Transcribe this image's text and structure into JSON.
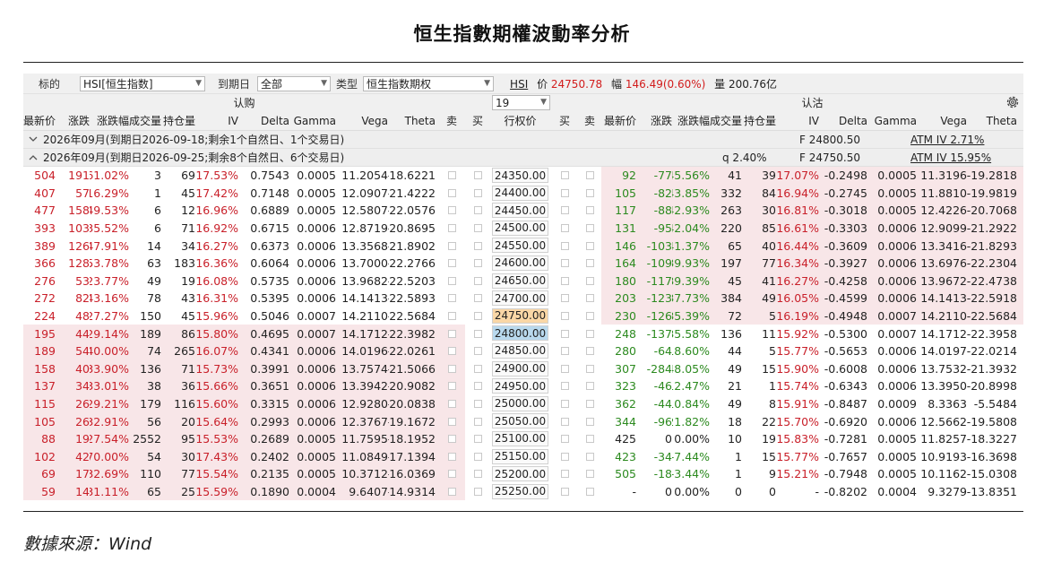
{
  "title": "恒生指數期權波動率分析",
  "source": "數據來源：Wind",
  "toolbar": {
    "underlying_label": "标的",
    "underlying_value": "HSI[恒生指数]",
    "expiry_label": "到期日",
    "expiry_value": "全部",
    "type_label": "类型",
    "type_value": "恒生指数期权",
    "quote_symbol": "HSI",
    "price_label": "价",
    "price_value": "24750.78",
    "change_label": "幅",
    "change_value": "146.49(0.60%)",
    "volume_label": "量",
    "volume_value": "200.76亿"
  },
  "header": {
    "call_label": "认购",
    "put_label": "认沽",
    "strike_count_value": "19",
    "call_cols": [
      "最新价",
      "涨跌",
      "涨跌幅",
      "成交量",
      "持仓量",
      "IV",
      "Delta",
      "Gamma",
      "Vega",
      "Theta"
    ],
    "mid_cols": [
      "卖",
      "买",
      "行权价",
      "买",
      "卖"
    ],
    "put_cols": [
      "最新价",
      "涨跌",
      "涨跌幅",
      "成交量",
      "持仓量",
      "IV",
      "Delta",
      "Gamma",
      "Vega",
      "Theta"
    ]
  },
  "groups": [
    {
      "label": "2026年09月(到期日2026-09-18;剩余1个自然日、1个交易日)",
      "f": "F  24800.50",
      "q": "",
      "atm": "ATM IV 2.71%",
      "expanded": false
    },
    {
      "label": "2026年09月(到期日2026-09-25;剩余8个自然日、6个交易日)",
      "f": "F  24750.50",
      "q": "q  2.40%",
      "atm": "ATM IV 15.95%",
      "expanded": true
    }
  ],
  "colors": {
    "up": "#c9202a",
    "down": "#2c8a1f",
    "itm_band": "#f8e6e8",
    "atm_strike": "#fad7a6",
    "near_strike": "#b9d9ee"
  },
  "rows": [
    {
      "strike": "24350.00",
      "call": [
        "504",
        "191",
        "61.02%",
        "3",
        "69",
        "17.53%",
        "0.7543",
        "0.0005",
        "11.2054",
        "-18.6221"
      ],
      "put": [
        "92",
        "-77",
        "-45.56%",
        "41",
        "39",
        "17.07%",
        "-0.2498",
        "0.0005",
        "11.3196",
        "-19.2818"
      ]
    },
    {
      "strike": "24400.00",
      "call": [
        "407",
        "57",
        "16.29%",
        "1",
        "45",
        "17.42%",
        "0.7148",
        "0.0005",
        "12.0907",
        "-21.4222"
      ],
      "put": [
        "105",
        "-82",
        "-43.85%",
        "332",
        "84",
        "16.94%",
        "-0.2745",
        "0.0005",
        "11.8810",
        "-19.9819"
      ]
    },
    {
      "strike": "24450.00",
      "call": [
        "477",
        "158",
        "49.53%",
        "6",
        "12",
        "16.96%",
        "0.6889",
        "0.0005",
        "12.5807",
        "-22.0576"
      ],
      "put": [
        "117",
        "-88",
        "-42.93%",
        "263",
        "30",
        "16.81%",
        "-0.3018",
        "0.0005",
        "12.4226",
        "-20.7068"
      ]
    },
    {
      "strike": "24500.00",
      "call": [
        "393",
        "103",
        "35.52%",
        "6",
        "71",
        "16.92%",
        "0.6715",
        "0.0006",
        "12.8719",
        "-20.8695"
      ],
      "put": [
        "131",
        "-95",
        "-42.04%",
        "220",
        "85",
        "16.61%",
        "-0.3303",
        "0.0006",
        "12.9099",
        "-21.2922"
      ]
    },
    {
      "strike": "24550.00",
      "call": [
        "389",
        "126",
        "47.91%",
        "14",
        "34",
        "16.27%",
        "0.6373",
        "0.0006",
        "13.3568",
        "-21.8902"
      ],
      "put": [
        "146",
        "-103",
        "-41.37%",
        "65",
        "40",
        "16.44%",
        "-0.3609",
        "0.0006",
        "13.3416",
        "-21.8293"
      ]
    },
    {
      "strike": "24600.00",
      "call": [
        "366",
        "128",
        "53.78%",
        "63",
        "183",
        "16.36%",
        "0.6064",
        "0.0006",
        "13.7000",
        "-22.2766"
      ],
      "put": [
        "164",
        "-109",
        "-39.93%",
        "197",
        "77",
        "16.34%",
        "-0.3927",
        "0.0006",
        "13.6976",
        "-22.2304"
      ]
    },
    {
      "strike": "24650.00",
      "call": [
        "276",
        "53",
        "23.77%",
        "49",
        "19",
        "16.08%",
        "0.5735",
        "0.0006",
        "13.9682",
        "-22.5203"
      ],
      "put": [
        "180",
        "-117",
        "-39.39%",
        "45",
        "41",
        "16.27%",
        "-0.4258",
        "0.0006",
        "13.9672",
        "-22.4738"
      ]
    },
    {
      "strike": "24700.00",
      "call": [
        "272",
        "82",
        "43.16%",
        "78",
        "43",
        "16.31%",
        "0.5395",
        "0.0006",
        "14.1413",
        "-22.5893"
      ],
      "put": [
        "203",
        "-123",
        "-37.73%",
        "384",
        "49",
        "16.05%",
        "-0.4599",
        "0.0006",
        "14.1413",
        "-22.5918"
      ]
    },
    {
      "strike": "24750.00",
      "call": [
        "224",
        "48",
        "27.27%",
        "150",
        "45",
        "15.96%",
        "0.5046",
        "0.0007",
        "14.2110",
        "-22.5684"
      ],
      "put": [
        "230",
        "-126",
        "-35.39%",
        "72",
        "5",
        "16.19%",
        "-0.4948",
        "0.0007",
        "14.2110",
        "-22.5684"
      ]
    },
    {
      "strike": "24800.00",
      "call": [
        "195",
        "44",
        "29.14%",
        "189",
        "86",
        "15.80%",
        "0.4695",
        "0.0007",
        "14.1712",
        "-22.3982"
      ],
      "put": [
        "248",
        "-137",
        "-35.58%",
        "136",
        "11",
        "15.92%",
        "-0.5300",
        "0.0007",
        "14.1712",
        "-22.3958"
      ]
    },
    {
      "strike": "24850.00",
      "call": [
        "189",
        "54",
        "40.00%",
        "74",
        "265",
        "16.07%",
        "0.4341",
        "0.0006",
        "14.0196",
        "-22.0261"
      ],
      "put": [
        "280",
        "-64",
        "-18.60%",
        "44",
        "5",
        "15.77%",
        "-0.5653",
        "0.0006",
        "14.0197",
        "-22.0214"
      ]
    },
    {
      "strike": "24900.00",
      "call": [
        "158",
        "40",
        "33.90%",
        "136",
        "71",
        "15.73%",
        "0.3991",
        "0.0006",
        "13.7574",
        "-21.5066"
      ],
      "put": [
        "307",
        "-284",
        "-48.05%",
        "49",
        "15",
        "15.90%",
        "-0.6008",
        "0.0006",
        "13.7532",
        "-21.3932"
      ]
    },
    {
      "strike": "24950.00",
      "call": [
        "137",
        "34",
        "33.01%",
        "38",
        "36",
        "15.66%",
        "0.3651",
        "0.0006",
        "13.3942",
        "-20.9082"
      ],
      "put": [
        "323",
        "-46",
        "-12.47%",
        "21",
        "1",
        "15.74%",
        "-0.6343",
        "0.0006",
        "13.3950",
        "-20.8998"
      ]
    },
    {
      "strike": "25000.00",
      "call": [
        "115",
        "26",
        "29.21%",
        "179",
        "116",
        "15.60%",
        "0.3315",
        "0.0006",
        "12.9280",
        "-20.0838"
      ],
      "put": [
        "362",
        "-44",
        "-10.84%",
        "49",
        "8",
        "15.91%",
        "-0.8487",
        "0.0009",
        "8.3363",
        "-5.5484"
      ]
    },
    {
      "strike": "25050.00",
      "call": [
        "105",
        "26",
        "32.91%",
        "56",
        "20",
        "15.64%",
        "0.2993",
        "0.0006",
        "12.3767",
        "-19.1672"
      ],
      "put": [
        "344",
        "-96",
        "-21.82%",
        "18",
        "22",
        "15.70%",
        "-0.6920",
        "0.0006",
        "12.5662",
        "-19.5808"
      ]
    },
    {
      "strike": "25100.00",
      "call": [
        "88",
        "19",
        "27.54%",
        "2552",
        "95",
        "15.53%",
        "0.2689",
        "0.0005",
        "11.7595",
        "-18.1952"
      ],
      "put": [
        "425",
        "0",
        "0.00%",
        "10",
        "19",
        "15.83%",
        "-0.7281",
        "0.0005",
        "11.8257",
        "-18.3227"
      ]
    },
    {
      "strike": "25150.00",
      "call": [
        "102",
        "42",
        "70.00%",
        "54",
        "30",
        "17.43%",
        "0.2402",
        "0.0005",
        "11.0849",
        "-17.1394"
      ],
      "put": [
        "423",
        "-34",
        "-7.44%",
        "1",
        "15",
        "15.77%",
        "-0.7657",
        "0.0005",
        "10.9193",
        "-16.3698"
      ]
    },
    {
      "strike": "25200.00",
      "call": [
        "69",
        "17",
        "32.69%",
        "110",
        "77",
        "15.54%",
        "0.2135",
        "0.0005",
        "10.3712",
        "-16.0369"
      ],
      "put": [
        "505",
        "-18",
        "-3.44%",
        "1",
        "9",
        "15.21%",
        "-0.7948",
        "0.0005",
        "10.1162",
        "-15.0308"
      ]
    },
    {
      "strike": "25250.00",
      "call": [
        "59",
        "14",
        "31.11%",
        "65",
        "25",
        "15.59%",
        "0.1890",
        "0.0004",
        "9.6407",
        "-14.9314"
      ],
      "put": [
        "-",
        "0",
        "0.00%",
        "0",
        "0",
        "-",
        "-0.8202",
        "0.0004",
        "9.3279",
        "-13.8351"
      ]
    }
  ]
}
